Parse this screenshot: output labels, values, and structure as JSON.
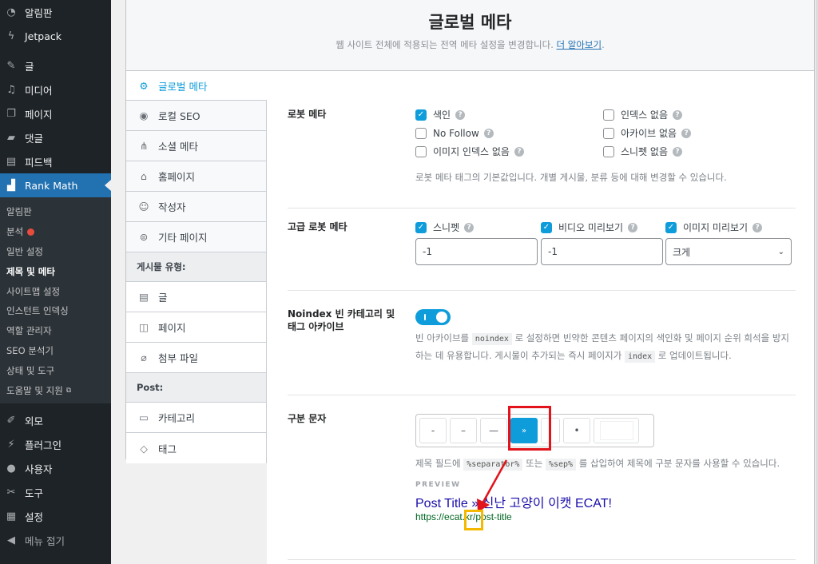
{
  "wp_menu": {
    "top_items": [
      {
        "label": "알림판",
        "icon": "dashboard-icon"
      },
      {
        "label": "Jetpack",
        "icon": "jetpack-icon"
      }
    ],
    "items": [
      {
        "label": "글",
        "icon": "pushpin-icon"
      },
      {
        "label": "미디어",
        "icon": "media-icon"
      },
      {
        "label": "페이지",
        "icon": "pages-icon"
      },
      {
        "label": "댓글",
        "icon": "comment-icon"
      },
      {
        "label": "피드백",
        "icon": "feedback-icon"
      }
    ],
    "rank_math": {
      "label": "Rank Math",
      "icon": "rank-math-icon"
    },
    "submenu": [
      {
        "label": "알림판"
      },
      {
        "label": "분석",
        "badge": "red-dot"
      },
      {
        "label": "일반 설정"
      },
      {
        "label": "제목 및 메타",
        "current": true
      },
      {
        "label": "사이트맵 설정"
      },
      {
        "label": "인스턴트 인덱싱"
      },
      {
        "label": "역할 관리자"
      },
      {
        "label": "SEO 분석기"
      },
      {
        "label": "상태 및 도구"
      },
      {
        "label": "도움말 및 지원",
        "external": true
      }
    ],
    "bottom_items": [
      {
        "label": "외모",
        "icon": "brush-icon"
      },
      {
        "label": "플러그인",
        "icon": "plugin-icon"
      },
      {
        "label": "사용자",
        "icon": "user-icon"
      },
      {
        "label": "도구",
        "icon": "wrench-icon"
      },
      {
        "label": "설정",
        "icon": "settings-icon"
      },
      {
        "label": "메뉴 접기",
        "icon": "collapse-icon"
      }
    ]
  },
  "header": {
    "title": "글로벌 메타",
    "subtitle": "웹 사이트 전체에 적용되는 전역 메타 설정을 변경합니다.",
    "learn_more": "더 알아보기",
    "period": "."
  },
  "tabs": {
    "items": [
      {
        "label": "글로벌 메타",
        "icon": "gear-icon",
        "active": true
      },
      {
        "label": "로컬 SEO",
        "icon": "location-pin-icon"
      },
      {
        "label": "소셜 메타",
        "icon": "share-nodes-icon"
      },
      {
        "label": "홈페이지",
        "icon": "home-icon"
      },
      {
        "label": "작성자",
        "icon": "users-icon"
      },
      {
        "label": "기타 페이지",
        "icon": "list-circle-icon"
      }
    ],
    "post_types_heading": "게시물 유형:",
    "post_types": [
      {
        "label": "글",
        "icon": "document-icon"
      },
      {
        "label": "페이지",
        "icon": "page-icon"
      },
      {
        "label": "첨부 파일",
        "icon": "paperclip-icon"
      }
    ],
    "post_heading": "Post:",
    "taxonomies": [
      {
        "label": "카테고리",
        "icon": "folder-icon"
      },
      {
        "label": "태그",
        "icon": "tag-icon"
      }
    ]
  },
  "robots_meta": {
    "label": "로봇 메타",
    "left": [
      {
        "label": "색인",
        "checked": true
      },
      {
        "label": "No Follow",
        "checked": false
      },
      {
        "label": "이미지 인덱스 없음",
        "checked": false
      }
    ],
    "right": [
      {
        "label": "인덱스 없음",
        "checked": false
      },
      {
        "label": "아카이브 없음",
        "checked": false
      },
      {
        "label": "스니펫 없음",
        "checked": false
      }
    ],
    "description": "로봇 메타 태그의 기본값입니다. 개별 게시물, 분류 등에 대해 변경할 수 있습니다."
  },
  "advanced_robots": {
    "label": "고급 로봇 메타",
    "fields": [
      {
        "label": "스니펫",
        "checked": true,
        "value": "-1"
      },
      {
        "label": "비디오 미리보기",
        "checked": true,
        "value": "-1"
      },
      {
        "label": "이미지 미리보기",
        "checked": true,
        "value": "크게"
      }
    ]
  },
  "noindex_empty": {
    "label": "Noindex 빈 카테고리 및 태그 아카이브",
    "enabled": true,
    "desc_1": "빈 아카이브를 ",
    "code_1": "noindex",
    "desc_2": " 로 설정하면 빈약한 콘텐츠 페이지의 색인화 및 페이지 순위 희석을 방지하는 데 유용합니다. 게시물이 추가되는 즉시 페이지가 ",
    "code_2": "index",
    "desc_3": " 로 업데이트됩니다."
  },
  "separator": {
    "label": "구분 문자",
    "options": [
      "-",
      "–",
      "—",
      "»",
      "|",
      "•",
      ""
    ],
    "selected": "»",
    "desc_1": "제목 필드에 ",
    "code_1": "%separator%",
    "desc_2": " 또는 ",
    "code_2": "%sep%",
    "desc_3": " 를 삽입하여 제목에 구분 문자를 사용할 수 있습니다.",
    "preview_label": "PREVIEW",
    "preview_title_a": "Post Title ",
    "preview_sep": "»",
    "preview_title_b": " 신난 고양이 이캣 ECAT!",
    "preview_url": "https://ecat.kr/post-title"
  },
  "colors": {
    "accent": "#0e9cdb",
    "wp_sidebar": "#1d2327",
    "wp_active": "#2271b1",
    "annotation_red": "#e2131b",
    "annotation_yellow": "#f5b800"
  }
}
